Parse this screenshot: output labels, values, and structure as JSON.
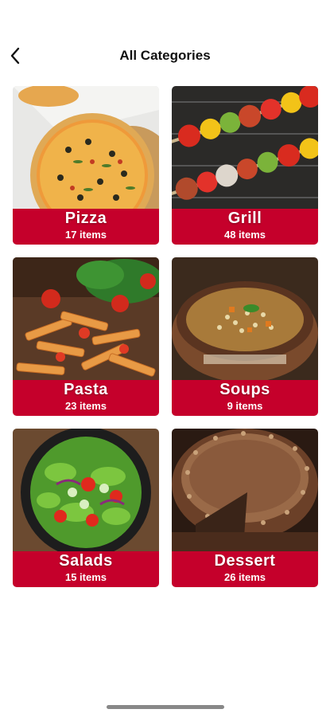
{
  "header": {
    "title": "All Categories",
    "back_icon": "chevron-left-icon"
  },
  "theme": {
    "accent": "#c5002b",
    "background": "#ffffff"
  },
  "categories": [
    {
      "name": "Pizza",
      "count": "17 items"
    },
    {
      "name": "Grill",
      "count": "48 items"
    },
    {
      "name": "Pasta",
      "count": "23 items"
    },
    {
      "name": "Soups",
      "count": "9 items"
    },
    {
      "name": "Salads",
      "count": "15 items"
    },
    {
      "name": "Dessert",
      "count": "26 items"
    }
  ]
}
